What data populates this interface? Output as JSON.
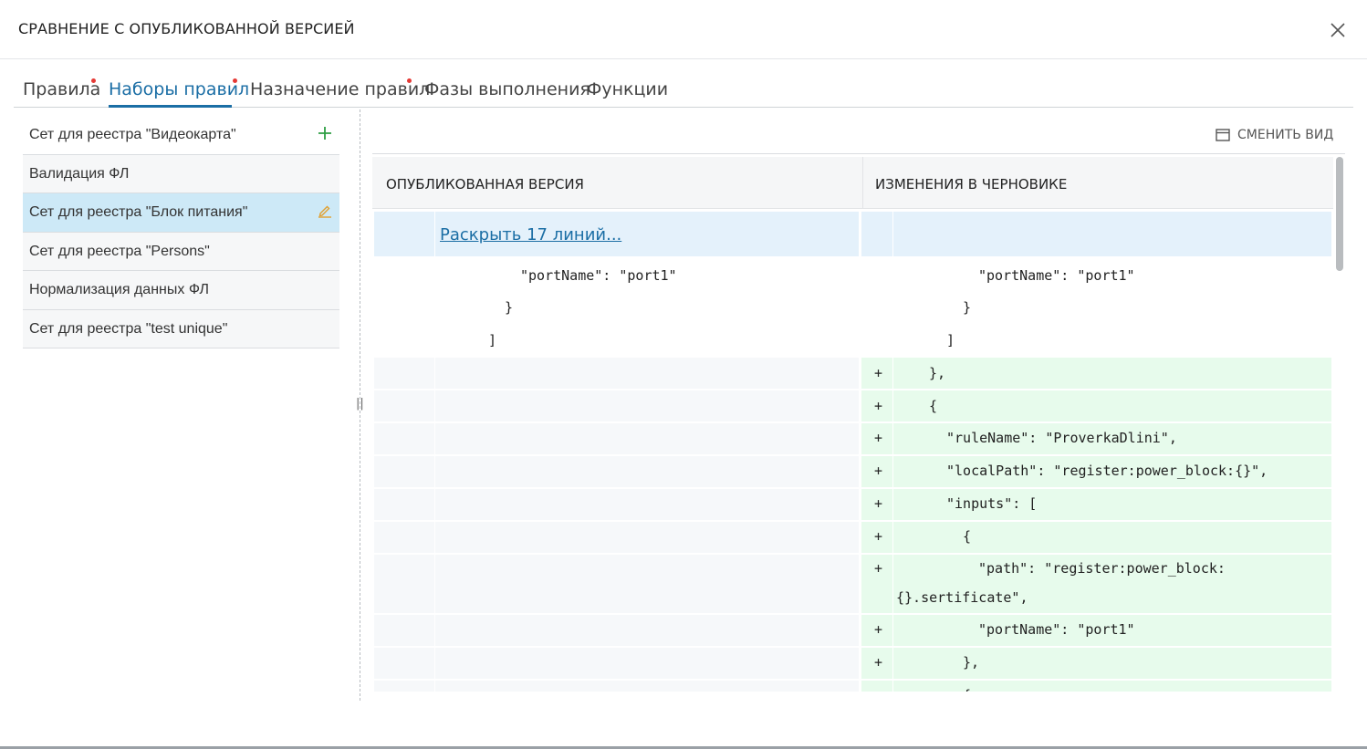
{
  "dialog": {
    "title": "СРАВНЕНИЕ С ОПУБЛИКОВАННОЙ ВЕРСИЕЙ",
    "close_icon": "close-icon"
  },
  "tabs": [
    {
      "label": "Правила",
      "changed": true
    },
    {
      "label": "Наборы правил",
      "changed": true,
      "active": true
    },
    {
      "label": "Назначение правил",
      "changed": true
    },
    {
      "label": "Фазы выполнения",
      "changed": false
    },
    {
      "label": "Функции",
      "changed": false
    }
  ],
  "sidebar": {
    "items": [
      {
        "label": "Сет для реестра \"Видеокарта\"",
        "icon": "plus-icon"
      },
      {
        "label": "Валидация ФЛ"
      },
      {
        "label": "Сет для реестра \"Блок питания\"",
        "icon": "edit-icon",
        "selected": true
      },
      {
        "label": "Сет для реестра \"Persons\""
      },
      {
        "label": "Нормализация данных ФЛ"
      },
      {
        "label": "Сет для реестра \"test unique\""
      }
    ]
  },
  "toolbar": {
    "switch_view_label": "СМЕНИТЬ ВИД",
    "switch_view_icon": "view-layout-icon"
  },
  "diff": {
    "published_header": "ОПУБЛИКОВАННАЯ ВЕРСИЯ",
    "draft_header": "ИЗМЕНЕНИЯ В ЧЕРНОВИКЕ",
    "expand_label": "Раскрыть 17 линий...",
    "context_lines": [
      {
        "left": "\"portName\": \"port1\"",
        "right": "\"portName\": \"port1\""
      },
      {
        "left": "}",
        "right": "}"
      },
      {
        "left": "]",
        "right": "]"
      }
    ],
    "added_marker": "+",
    "added_lines": [
      "},",
      "{",
      "\"ruleName\": \"ProverkaDlini\",",
      "\"localPath\": \"register:power_block:{}\",",
      "\"inputs\": [",
      "{",
      "\"path\": \"register:power_block:",
      "{}.sertificate\",",
      "\"portName\": \"port1\"",
      "},",
      "{"
    ]
  },
  "colors": {
    "accent": "#1b6ea5",
    "added_bg": "#e7fbec",
    "expand_bg": "#e4f1fb",
    "selected_bg": "#cde9f7",
    "changed_dot": "#e53935",
    "plus_icon": "#2e9e44",
    "edit_icon": "#e0a030"
  }
}
